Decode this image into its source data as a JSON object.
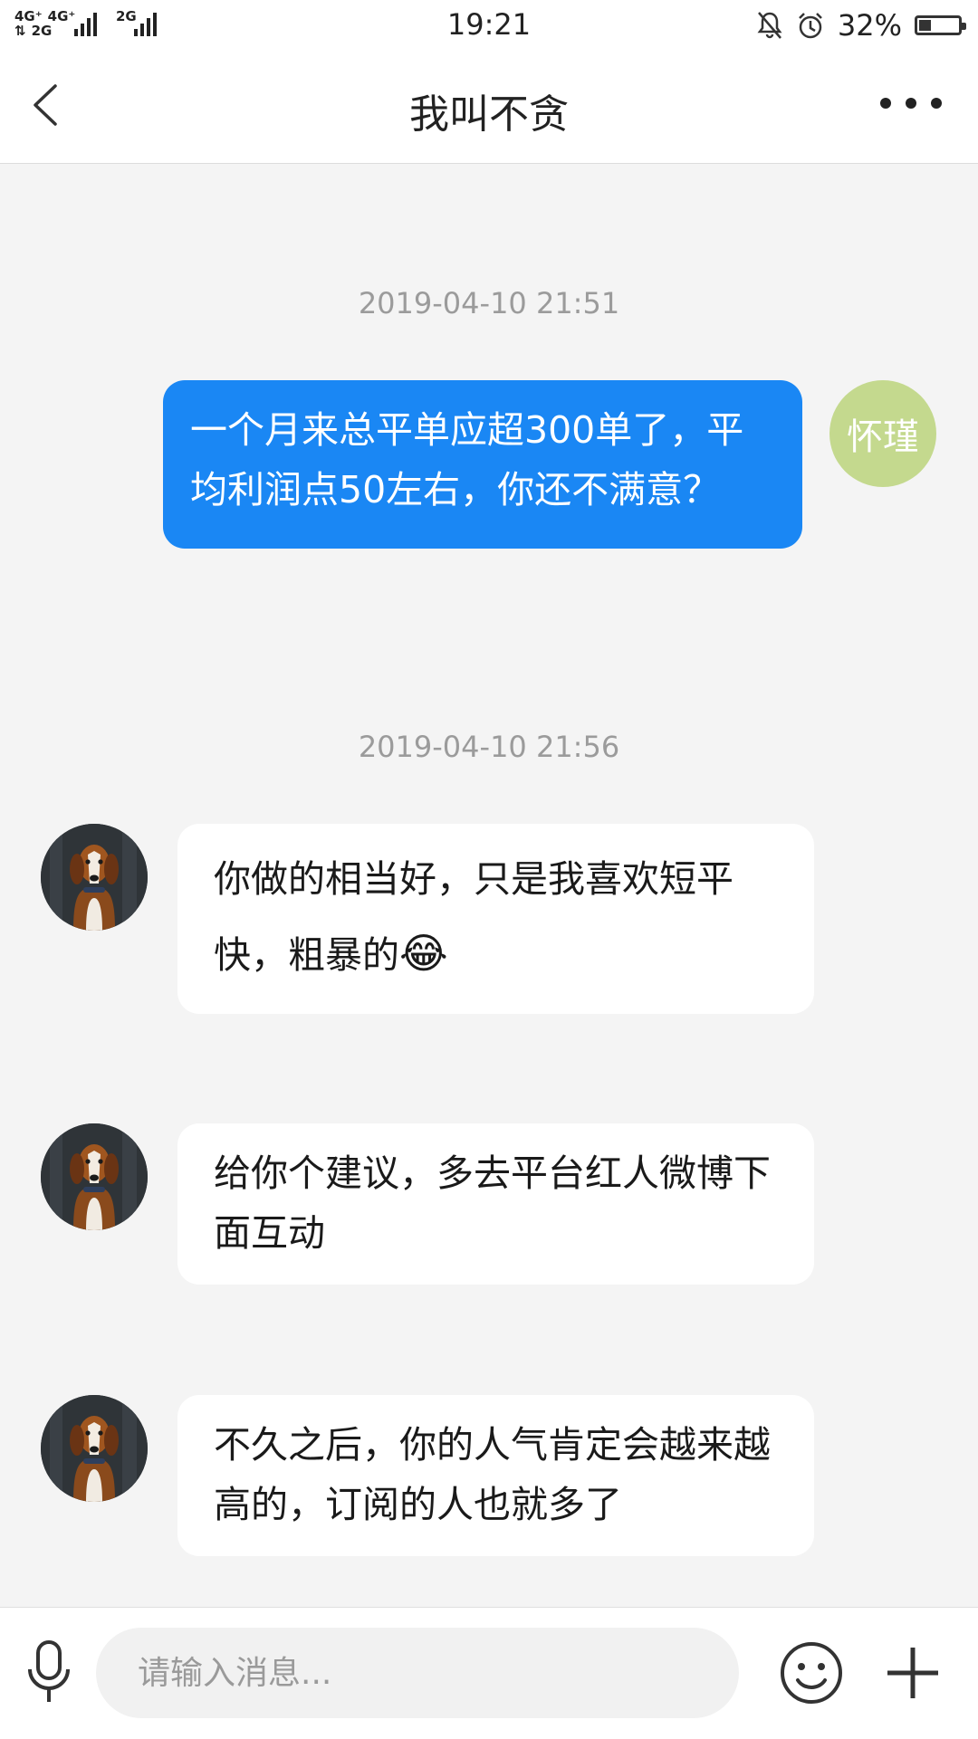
{
  "status_bar": {
    "network_top": [
      "4G⁺",
      "4G⁺"
    ],
    "network_bottom": [
      "⇅",
      "2G",
      "2G"
    ],
    "time": "19:21",
    "battery_percent": "32%",
    "battery_level": 0.32
  },
  "header": {
    "title": "我叫不贪"
  },
  "messages": [
    {
      "type": "timestamp",
      "text": "2019-04-10 21:51"
    },
    {
      "type": "self",
      "avatar_text": "怀瑾",
      "text": "一个月来总平单应超300单了，平均利润点50左右，你还不满意？"
    },
    {
      "type": "timestamp",
      "text": "2019-04-10 21:56"
    },
    {
      "type": "peer",
      "text": "你做的相当好，只是我喜欢短平快，粗暴的",
      "emoji": "😂"
    },
    {
      "type": "peer",
      "text": "给你个建议，多去平台红人微博下面互动"
    },
    {
      "type": "peer",
      "text": "不久之后，你的人气肯定会越来越高的，订阅的人也就多了"
    }
  ],
  "input_bar": {
    "placeholder": "请输入消息..."
  },
  "icons": {
    "back": "back-icon",
    "more": "more-icon",
    "mic": "microphone-icon",
    "emoji": "smiley-icon",
    "plus": "plus-icon",
    "mute": "bell-off-icon",
    "alarm": "alarm-clock-icon"
  },
  "colors": {
    "self_bubble": "#1a87f4",
    "self_avatar": "#c4d98e",
    "background": "#f4f4f4"
  }
}
